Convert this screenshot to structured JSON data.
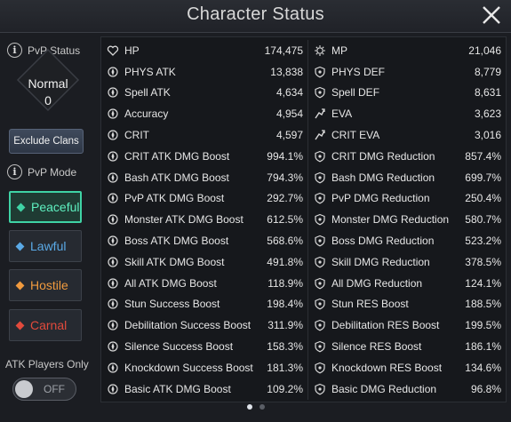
{
  "window": {
    "title": "Character Status"
  },
  "left_panel": {
    "pvp_status_label": "PvP Status",
    "status_value": "Normal",
    "status_count": "0",
    "exclude_clans_label": "Exclude Clans",
    "pvp_mode_label": "PvP Mode",
    "modes": [
      {
        "label": "Peaceful",
        "color": "#3fd3a5",
        "active": true
      },
      {
        "label": "Lawful",
        "color": "#5aa9e6",
        "active": false
      },
      {
        "label": "Hostile",
        "color": "#f09a3e",
        "active": false
      },
      {
        "label": "Carnal",
        "color": "#e24a3c",
        "active": false
      }
    ],
    "atk_players_label": "ATK Players Only",
    "atk_players_toggle": "OFF"
  },
  "stats_left": [
    {
      "name": "HP",
      "value": "174,475",
      "icon": "heart-icon"
    },
    {
      "name": "PHYS ATK",
      "value": "13,838",
      "icon": "sword-icon"
    },
    {
      "name": "Spell ATK",
      "value": "4,634",
      "icon": "magic-icon"
    },
    {
      "name": "Accuracy",
      "value": "4,954",
      "icon": "target-icon"
    },
    {
      "name": "CRIT",
      "value": "4,597",
      "icon": "crit-icon"
    },
    {
      "name": "CRIT ATK DMG Boost",
      "value": "994.1%",
      "icon": "crit-boost-icon"
    },
    {
      "name": "Bash ATK DMG Boost",
      "value": "794.3%",
      "icon": "bash-icon"
    },
    {
      "name": "PvP ATK DMG Boost",
      "value": "292.7%",
      "icon": "pvp-icon"
    },
    {
      "name": "Monster ATK DMG Boost",
      "value": "612.5%",
      "icon": "monster-icon"
    },
    {
      "name": "Boss ATK DMG Boost",
      "value": "568.6%",
      "icon": "boss-icon"
    },
    {
      "name": "Skill ATK DMG Boost",
      "value": "491.8%",
      "icon": "skill-icon"
    },
    {
      "name": "All ATK DMG Boost",
      "value": "118.9%",
      "icon": "all-atk-icon"
    },
    {
      "name": "Stun Success Boost",
      "value": "198.4%",
      "icon": "stun-icon"
    },
    {
      "name": "Debilitation Success Boost",
      "value": "311.9%",
      "icon": "debilitation-icon"
    },
    {
      "name": "Silence Success Boost",
      "value": "158.3%",
      "icon": "silence-icon"
    },
    {
      "name": "Knockdown Success Boost",
      "value": "181.3%",
      "icon": "knockdown-icon"
    },
    {
      "name": "Basic ATK DMG Boost",
      "value": "109.2%",
      "icon": "basic-atk-icon"
    }
  ],
  "stats_right": [
    {
      "name": "MP",
      "value": "21,046",
      "icon": "mp-icon"
    },
    {
      "name": "PHYS DEF",
      "value": "8,779",
      "icon": "shield-icon"
    },
    {
      "name": "Spell DEF",
      "value": "8,631",
      "icon": "spell-shield-icon"
    },
    {
      "name": "EVA",
      "value": "3,623",
      "icon": "evasion-icon"
    },
    {
      "name": "CRIT EVA",
      "value": "3,016",
      "icon": "crit-eva-icon"
    },
    {
      "name": "CRIT DMG Reduction",
      "value": "857.4%",
      "icon": "shield-icon"
    },
    {
      "name": "Bash DMG Reduction",
      "value": "699.7%",
      "icon": "shield-icon"
    },
    {
      "name": "PvP DMG Reduction",
      "value": "250.4%",
      "icon": "shield-icon"
    },
    {
      "name": "Monster DMG Reduction",
      "value": "580.7%",
      "icon": "shield-icon"
    },
    {
      "name": "Boss DMG Reduction",
      "value": "523.2%",
      "icon": "shield-icon"
    },
    {
      "name": "Skill DMG Reduction",
      "value": "378.5%",
      "icon": "shield-icon"
    },
    {
      "name": "All DMG Reduction",
      "value": "124.1%",
      "icon": "all-def-icon"
    },
    {
      "name": "Stun RES Boost",
      "value": "188.5%",
      "icon": "shield-icon"
    },
    {
      "name": "Debilitation RES Boost",
      "value": "199.5%",
      "icon": "shield-icon"
    },
    {
      "name": "Silence RES Boost",
      "value": "186.1%",
      "icon": "shield-icon"
    },
    {
      "name": "Knockdown RES Boost",
      "value": "134.6%",
      "icon": "shield-icon"
    },
    {
      "name": "Basic DMG Reduction",
      "value": "96.8%",
      "icon": "shield-icon"
    }
  ],
  "pagination": {
    "current": 1,
    "total": 2
  }
}
